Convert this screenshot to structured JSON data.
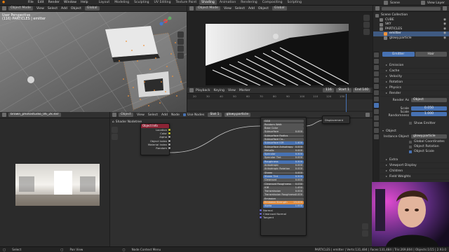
{
  "topbar": {
    "menu": [
      "File",
      "Edit",
      "Render",
      "Window",
      "Help"
    ],
    "workspaces": [
      "Layout",
      "Modeling",
      "Sculpting",
      "UV Editing",
      "Texture Paint",
      "Shading",
      "Animation",
      "Rendering",
      "Compositing",
      "Scripting"
    ],
    "active_workspace": "Shading",
    "scene": "Scene",
    "view_layer": "View Layer"
  },
  "viewport3d": {
    "header": [
      "Object Mode",
      "View",
      "Select",
      "Add",
      "Object"
    ],
    "transform": "Global",
    "overlay_title": "User Perspective",
    "overlay_sub": "(116) PARTICLES | emitter"
  },
  "render_view": {
    "header": [
      "Object Mode",
      "View",
      "Select",
      "Add",
      "Object"
    ],
    "transform": "Global"
  },
  "timeline": {
    "header": [
      "Playback",
      "Keying",
      "View",
      "Marker"
    ],
    "current_frame": "116",
    "start_label": "Start",
    "start": "1",
    "end_label": "End",
    "end": "140",
    "ticks": [
      "20",
      "30",
      "40",
      "50",
      "60",
      "70",
      "80",
      "90",
      "100",
      "110",
      "120",
      "130"
    ]
  },
  "image_editor": {
    "header": [
      "View",
      "View",
      "Image"
    ],
    "image_name": "brown_photostudio_06_2k.exr"
  },
  "node_editor": {
    "header": [
      "Object",
      "View",
      "Select",
      "Add",
      "Node"
    ],
    "use_nodes": "Use Nodes",
    "slot": "Slot 1",
    "material": "glowy.particle",
    "breadcrumb": "Shader Nodetree",
    "object_info": {
      "title": "Object Info",
      "outputs": [
        "Location",
        "Color",
        "Alpha",
        "Object Index",
        "Material Index",
        "Random"
      ]
    },
    "bsdf": {
      "title": "Principled BSDF",
      "outputs": [
        "BSDF"
      ],
      "rows": [
        {
          "l": "GGX",
          "v": "",
          "c": ""
        },
        {
          "l": "Random Walk",
          "v": "",
          "c": ""
        },
        {
          "l": "Base Color",
          "v": "",
          "c": ""
        },
        {
          "l": "Subsurface",
          "v": "0.000",
          "c": ""
        },
        {
          "l": "Subsurface Radius",
          "v": "",
          "c": ""
        },
        {
          "l": "Subsurface Co...",
          "v": "",
          "c": ""
        },
        {
          "l": "Subsurface IOR",
          "v": "1.400",
          "c": "b"
        },
        {
          "l": "Subsurface Anisotropy",
          "v": "0.000",
          "c": ""
        },
        {
          "l": "Metallic",
          "v": "0.000",
          "c": ""
        },
        {
          "l": "Specular",
          "v": "0.500",
          "c": "b"
        },
        {
          "l": "Specular Tint",
          "v": "0.000",
          "c": ""
        },
        {
          "l": "Roughness",
          "v": "0.500",
          "c": "b"
        },
        {
          "l": "Anisotropic",
          "v": "0.000",
          "c": ""
        },
        {
          "l": "Anisotropic Rotation",
          "v": "0.000",
          "c": ""
        },
        {
          "l": "Sheen",
          "v": "0.000",
          "c": ""
        },
        {
          "l": "Sheen Tint",
          "v": "0.500",
          "c": "b"
        },
        {
          "l": "Clearcoat",
          "v": "0.000",
          "c": ""
        },
        {
          "l": "Clearcoat Roughness",
          "v": "0.030",
          "c": ""
        },
        {
          "l": "IOR",
          "v": "1.450",
          "c": ""
        },
        {
          "l": "Transmission",
          "v": "0.000",
          "c": ""
        },
        {
          "l": "Transmission Roughness",
          "v": "0.000",
          "c": ""
        },
        {
          "l": "Emission",
          "v": "",
          "c": ""
        },
        {
          "l": "Emission Strength",
          "v": "25.000",
          "c": "o"
        },
        {
          "l": "Alpha",
          "v": "1.000",
          "c": "b"
        }
      ],
      "inputs": [
        "Normal",
        "Clearcoat Normal",
        "Tangent"
      ]
    },
    "output": {
      "title": "Displacement"
    }
  },
  "outliner": {
    "title": "Scene Collection",
    "items": [
      {
        "name": "CUBE",
        "indent": 1,
        "sel": false
      },
      {
        "name": "SKY",
        "indent": 1,
        "sel": false
      },
      {
        "name": "PARTICLES",
        "indent": 1,
        "sel": false
      },
      {
        "name": "emitter",
        "indent": 2,
        "sel": true
      },
      {
        "name": "glowy.particle",
        "indent": 2,
        "sel": false
      }
    ]
  },
  "properties": {
    "tabs": [
      "Emitter",
      "Hair"
    ],
    "sections": [
      "Emission",
      "Cache",
      "Velocity",
      "Rotation",
      "Physics",
      "Render"
    ],
    "render_as_label": "Render As",
    "render_as": "Object",
    "scale_label": "Scale",
    "scale": "0.050",
    "rand_label": "Scale Randomness",
    "rand": "1.000",
    "show_emitter": "Show Emitter",
    "object_section": "Object",
    "instance_label": "Instance Object",
    "instance": "glowy.particle",
    "checks": [
      "Global Coordinates",
      "Object Rotation",
      "Object Scale"
    ],
    "more": [
      "Extra",
      "Viewport Display",
      "Children",
      "Field Weights"
    ]
  },
  "statusbar": {
    "select": "Select",
    "pan": "Pan View",
    "ctx": "Node Context Menu",
    "stats": "PARTICLES | emitter | Verts:131,484 | Faces:131,484 | Tris:269,804 | Objects:1/15 | 2.93.0"
  },
  "colors": {
    "accent": "#4772b3",
    "emission": "#e08a3a",
    "header": "#303030",
    "node_title": "#8b2435",
    "selection": "#f0923a"
  }
}
